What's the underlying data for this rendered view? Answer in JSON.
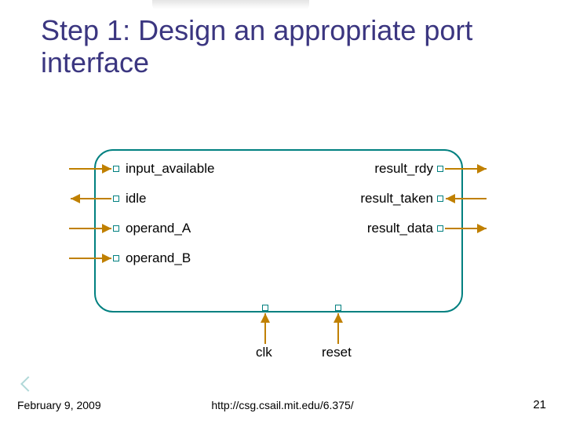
{
  "title": "Step 1: Design an appropriate port interface",
  "ports": {
    "left": [
      {
        "name": "input_available",
        "dir": "in"
      },
      {
        "name": "idle",
        "dir": "out"
      },
      {
        "name": "operand_A",
        "dir": "in"
      },
      {
        "name": "operand_B",
        "dir": "in"
      }
    ],
    "right": [
      {
        "name": "result_rdy",
        "dir": "out"
      },
      {
        "name": "result_taken",
        "dir": "in"
      },
      {
        "name": "result_data",
        "dir": "out"
      }
    ],
    "bottom": [
      {
        "name": "clk"
      },
      {
        "name": "reset"
      }
    ]
  },
  "footer": {
    "date": "February 9, 2009",
    "url": "http://csg.csail.mit.edu/6.375/",
    "page": "21"
  },
  "chart_data": {
    "type": "diagram",
    "title": "Step 1: Design an appropriate port interface",
    "description": "Rounded rectangle module with labeled ports. Left-side ports (with arrows indicating direction toward the module for inputs and away for outputs): input_available (in), idle (out), operand_A (in), operand_B (in). Right-side ports: result_rdy (out), result_taken (in), result_data (out). Bottom ports (driven upward into the module): clk, reset.",
    "nodes": [
      {
        "id": "module",
        "shape": "rounded-rect"
      }
    ],
    "ports_left": [
      "input_available",
      "idle",
      "operand_A",
      "operand_B"
    ],
    "ports_right": [
      "result_rdy",
      "result_taken",
      "result_data"
    ],
    "ports_bottom": [
      "clk",
      "reset"
    ]
  }
}
